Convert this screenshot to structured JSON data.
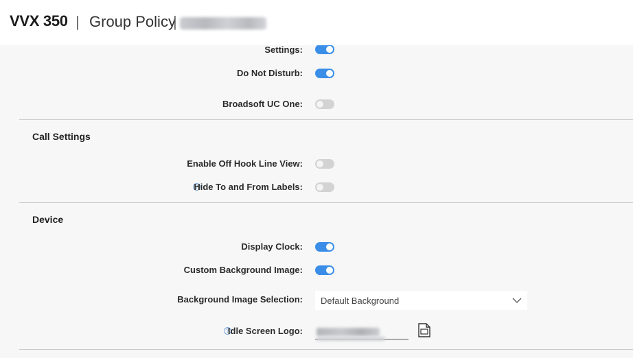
{
  "header": {
    "model": "VVX 350",
    "separator": "|",
    "policy": "Group Policy",
    "separator2": "|"
  },
  "rows_top": [
    {
      "label": "Settings:",
      "state": "on"
    },
    {
      "label": "Do Not Disturb:",
      "state": "on"
    },
    {
      "label": "Broadsoft UC One:",
      "state": "off"
    }
  ],
  "call_settings": {
    "title": "Call Settings",
    "rows": [
      {
        "label": "Enable Off Hook Line View:",
        "state": "off",
        "help": false
      },
      {
        "label": "Hide To and From Labels:",
        "state": "off",
        "help": true
      }
    ]
  },
  "device": {
    "title": "Device",
    "display_clock": {
      "label": "Display Clock:",
      "state": "on"
    },
    "custom_background": {
      "label": "Custom Background Image:",
      "state": "on"
    },
    "background_selection": {
      "label": "Background Image Selection:",
      "value": "Default Background"
    },
    "idle_screen_logo": {
      "label": "Idle Screen Logo:"
    }
  },
  "icons": {
    "help": "?",
    "chevron": "chevron-down-icon",
    "file": "file-icon"
  },
  "colors": {
    "toggle_on": "#3b8ee8",
    "toggle_off": "#d3d3d3",
    "help_icon": "#7aa9de"
  }
}
